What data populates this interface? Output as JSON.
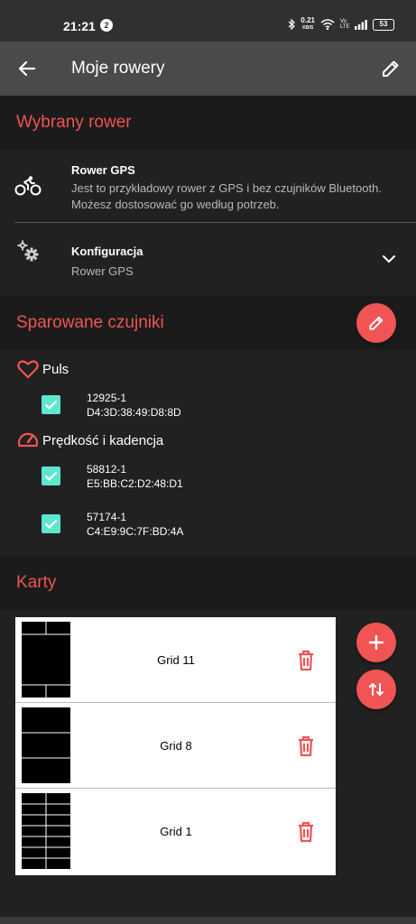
{
  "statusbar": {
    "time": "21:21",
    "notif_count": "2",
    "speed_value": "0.21",
    "speed_unit": "KB/S",
    "volte": "Vo LTE",
    "battery": "53"
  },
  "appbar": {
    "title": "Moje rowery",
    "back_icon": "arrow-left-icon",
    "edit_icon": "pencil-icon"
  },
  "selected_bike": {
    "heading": "Wybrany rower",
    "name": "Rower GPS",
    "description": "Jest to przykładowy rower z GPS i bez czujników Bluetooth. Możesz dostosować go według potrzeb.",
    "config_label": "Konfiguracja",
    "config_value": "Rower GPS"
  },
  "sensors": {
    "heading": "Sparowane czujniki",
    "groups": [
      {
        "name": "Puls",
        "icon": "heart-icon",
        "items": [
          {
            "id": "12925-1",
            "mac": "D4:3D:38:49:D8:8D",
            "checked": true
          }
        ]
      },
      {
        "name": "Prędkość i kadencja",
        "icon": "speedometer-icon",
        "items": [
          {
            "id": "58812-1",
            "mac": "E5:BB:C2:D2:48:D1",
            "checked": true
          },
          {
            "id": "57174-1",
            "mac": "C4:E9:9C:7F:BD:4A",
            "checked": true
          }
        ]
      }
    ]
  },
  "cards": {
    "heading": "Karty",
    "items": [
      {
        "name": "Grid 11"
      },
      {
        "name": "Grid 8"
      },
      {
        "name": "Grid 1"
      }
    ]
  },
  "colors": {
    "accent": "#f05454",
    "checkbox": "#5fe6cf",
    "background": "#212121",
    "appbar": "#4a4a4a"
  }
}
